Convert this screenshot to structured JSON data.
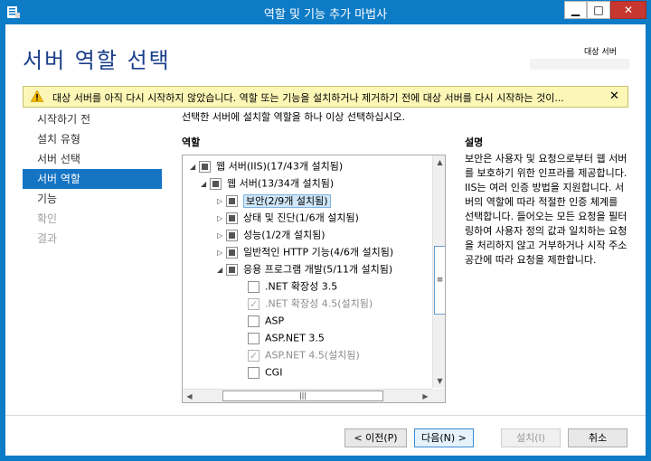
{
  "window": {
    "title": "역할 및 기능 추가 마법사",
    "minimize": "▁",
    "maximize": "□",
    "close": "✕"
  },
  "header": {
    "title": "서버 역할 선택",
    "target_label": "대상 서버"
  },
  "warning": {
    "text": "대상 서버를 아직 다시 시작하지 않았습니다. 역할 또는 기능을 설치하거나 제거하기 전에 대상 서버를 다시 시작하는 것이...",
    "close": "✕"
  },
  "nav": {
    "items": [
      {
        "label": "시작하기 전",
        "state": "normal"
      },
      {
        "label": "설치 유형",
        "state": "normal"
      },
      {
        "label": "서버 선택",
        "state": "normal"
      },
      {
        "label": "서버 역할",
        "state": "active"
      },
      {
        "label": "기능",
        "state": "normal"
      },
      {
        "label": "확인",
        "state": "disabled"
      },
      {
        "label": "결과",
        "state": "disabled"
      }
    ]
  },
  "main": {
    "instruction": "선택한 서버에 설치할 역할을 하나 이상 선택하십시오.",
    "roles_label": "역할",
    "description_label": "설명",
    "description_text": "보안은 사용자 및 요청으로부터 웹 서버를 보호하기 위한 인프라를 제공합니다. IIS는 여러 인증 방법을 지원합니다. 서버의 역할에 따라 적절한 인증 체계를 선택합니다. 들어오는 모든 요청을 필터링하여 사용자 정의 값과 일치하는 요청을 처리하지 않고 거부하거나 시작 주소 공간에 따라 요청을 제한합니다."
  },
  "tree": [
    {
      "label": "웹 서버(IIS)(17/43개 설치됨)",
      "expander": "◢",
      "check": "partial",
      "level": 0
    },
    {
      "label": "웹 서버(13/34개 설치됨)",
      "expander": "◢",
      "check": "partial",
      "level": 1
    },
    {
      "label": "보안(2/9개 설치됨)",
      "expander": "▷",
      "check": "partial",
      "level": 2,
      "selected": true
    },
    {
      "label": "상태 및 진단(1/6개 설치됨)",
      "expander": "▷",
      "check": "partial",
      "level": 2
    },
    {
      "label": "성능(1/2개 설치됨)",
      "expander": "▷",
      "check": "partial",
      "level": 2
    },
    {
      "label": "일반적인 HTTP 기능(4/6개 설치됨)",
      "expander": "▷",
      "check": "partial",
      "level": 2
    },
    {
      "label": "응용 프로그램 개발(5/11개 설치됨)",
      "expander": "◢",
      "check": "partial",
      "level": 2
    },
    {
      "label": ".NET 확장성 3.5",
      "expander": "",
      "check": "none",
      "level": 3
    },
    {
      "label": ".NET 확장성 4.5(설치됨)",
      "expander": "",
      "check": "checked-gray",
      "level": 3,
      "gray": true
    },
    {
      "label": "ASP",
      "expander": "",
      "check": "none",
      "level": 3
    },
    {
      "label": "ASP.NET 3.5",
      "expander": "",
      "check": "none",
      "level": 3
    },
    {
      "label": "ASP.NET 4.5(설치됨)",
      "expander": "",
      "check": "checked-gray",
      "level": 3,
      "gray": true
    },
    {
      "label": "CGI",
      "expander": "",
      "check": "none",
      "level": 3
    }
  ],
  "scrollbar": {
    "up": "▲",
    "down": "▼",
    "left": "◀",
    "right": "▶",
    "v_grip": "≡",
    "h_grip": "|||"
  },
  "buttons": {
    "prev": "< 이전(P)",
    "next": "다음(N) >",
    "install": "설치(I)",
    "cancel": "취소"
  }
}
